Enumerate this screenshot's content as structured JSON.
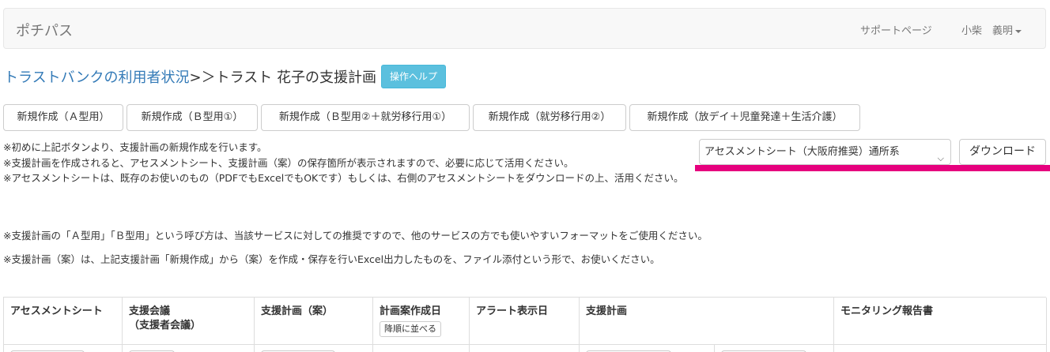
{
  "navbar": {
    "brand": "ポチパス",
    "support": "サポートページ",
    "user": "小柴　義明"
  },
  "breadcrumb": {
    "link": "トラストバンクの利用者状況",
    "separator": ">＞",
    "current": "トラスト 花子の支援計画"
  },
  "help_button": "操作ヘルプ",
  "create_buttons": [
    "新規作成（Ａ型用）",
    "新規作成（Ｂ型用①）",
    "新規作成（Ｂ型用②＋就労移行用①）",
    "新規作成（就労移行用②）",
    "新規作成（放デイ＋児童発達＋生活介護）"
  ],
  "notes": {
    "line1": "※初めに上記ボタンより、支援計画の新規作成を行います。",
    "line2": "※支援計画を作成されると、アセスメントシート、支援計画（案）の保存箇所が表示されますので、必要に応じて活用ください。",
    "line3": "※アセスメントシートは、既存のお使いのもの（PDFでもExcelでもOKです）もしくは、右側のアセスメントシートをダウンロードの上、活用ください。",
    "para1": "※支援計画の「Ａ型用」「Ｂ型用」という呼び方は、当該サービスに対しての推奨ですので、他のサービスの方でも使いやすいフォーマットをご使用ください。",
    "para2": "※支援計画（案）は、上記支援計画「新規作成」から（案）を作成・保存を行いExcel出力したものを、ファイル添付という形で、お使いください。"
  },
  "assessment_select": {
    "selected": "アセスメントシート（大阪府推奨）通所系"
  },
  "download_button": "ダウンロード",
  "table": {
    "headers": {
      "assessment": "アセスメントシート",
      "meeting_line1": "支援会議",
      "meeting_line2": "（支援者会議）",
      "draft": "支援計画（案）",
      "created_date": "計画案作成日",
      "sort_button": "降順に並べる",
      "alert_date": "アラート表示日",
      "plan": "支援計画",
      "monitoring": "モニタリング報告書"
    }
  },
  "colors": {
    "link": "#337ab7",
    "help_button": "#5bc0de",
    "highlight": "#e6007e"
  }
}
